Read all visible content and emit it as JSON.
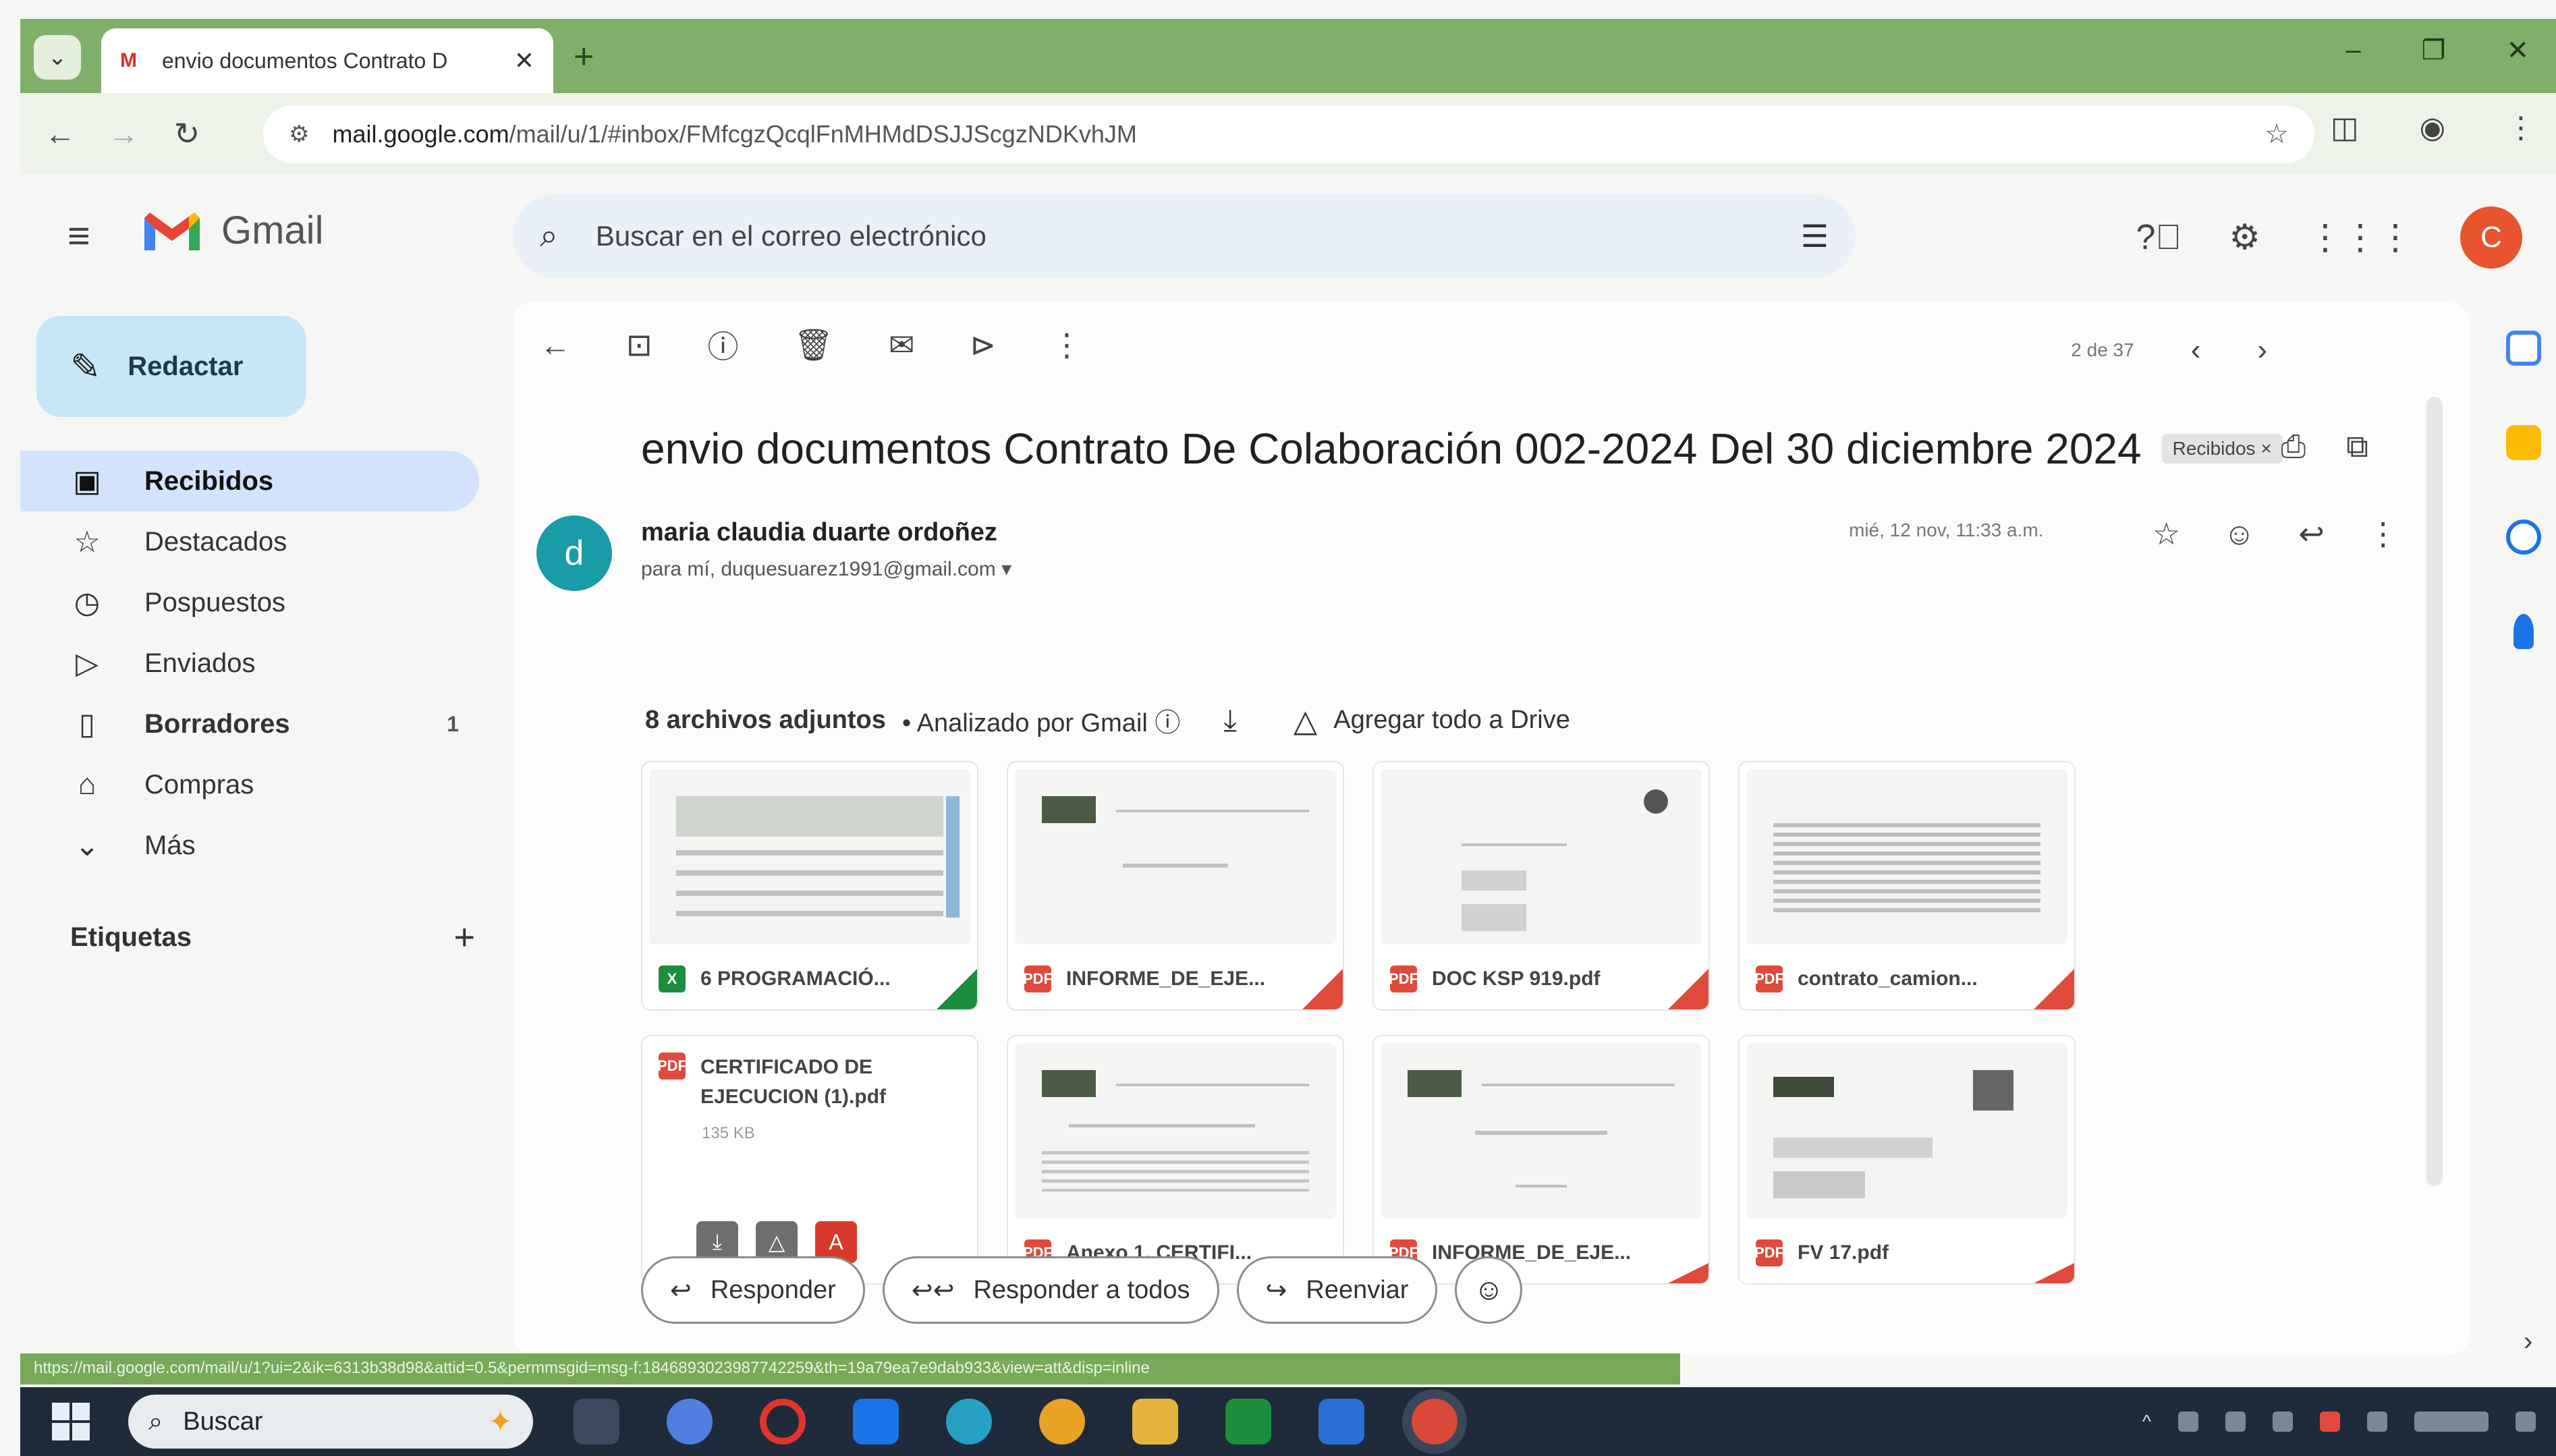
{
  "browser": {
    "tab_title": "envio documentos Contrato D",
    "tab_close": "✕",
    "new_tab": "+",
    "url_domain": "mail.google.com",
    "url_path": "/mail/u/1/#inbox/FMfcgzQcqlFnMHMdDSJJScgzNDKvhJM",
    "status_url": "https://mail.google.com/mail/u/1?ui=2&ik=6313b38d98&attid=0.5&permmsgid=msg-f:1846893023987742259&th=19a79ea7e9dab933&view=att&disp=inline"
  },
  "gmail": {
    "product_name": "Gmail",
    "search_placeholder": "Buscar en el correo electrónico",
    "avatar_letter": "C"
  },
  "sidebar": {
    "compose": "Redactar",
    "items": [
      {
        "label": "Recibidos",
        "icon": "inbox-icon",
        "count": ""
      },
      {
        "label": "Destacados",
        "icon": "star-icon",
        "count": ""
      },
      {
        "label": "Pospuestos",
        "icon": "clock-icon",
        "count": ""
      },
      {
        "label": "Enviados",
        "icon": "send-icon",
        "count": ""
      },
      {
        "label": "Borradores",
        "icon": "draft-icon",
        "count": "1"
      },
      {
        "label": "Compras",
        "icon": "shopping-icon",
        "count": ""
      },
      {
        "label": "Más",
        "icon": "chevron-down-icon",
        "count": ""
      }
    ],
    "labels_title": "Etiquetas"
  },
  "message": {
    "pager": "2 de 37",
    "subject": "envio documentos Contrato De Colaboración 002-2024 Del 30 diciembre 2024",
    "label_chip": "Recibidos ×",
    "sender_initial": "d",
    "sender_name": "maria claudia duarte ordoñez",
    "recipient": "para mí, duquesuarez1991@gmail.com ▾",
    "date": "mié, 12 nov, 11:33 a.m.",
    "attachments_count": "8 archivos adjuntos",
    "scanned": "• Analizado por Gmail ⓘ",
    "add_to_drive": "Agregar todo a Drive",
    "attachments": [
      {
        "name": "6 PROGRAMACIÓ...",
        "type": "xls"
      },
      {
        "name": "INFORME_DE_EJE...",
        "type": "pdf"
      },
      {
        "name": "DOC KSP 919.pdf",
        "type": "pdf"
      },
      {
        "name": "contrato_camion...",
        "type": "pdf"
      },
      {
        "name": "CERTIFICADO DE EJECUCION (1).pdf",
        "type": "pdf",
        "size": "135 KB"
      },
      {
        "name": "Anexo 1. CERTIFI...",
        "type": "pdf"
      },
      {
        "name": "INFORME_DE_EJE...",
        "type": "pdf"
      },
      {
        "name": "FV 17.pdf",
        "type": "pdf"
      }
    ],
    "reply": "Responder",
    "reply_all": "Responder a todos",
    "forward": "Reenviar"
  },
  "taskbar": {
    "search_label": "Buscar"
  },
  "colors": {
    "chrome_frame": "#7fb06a",
    "compose_bg": "#c6e7f7",
    "active_nav": "#d3e3fd",
    "sender_avatar": "#1a9ba8",
    "pdf_red": "#e04a3d",
    "sheet_green": "#1e8e3e"
  }
}
